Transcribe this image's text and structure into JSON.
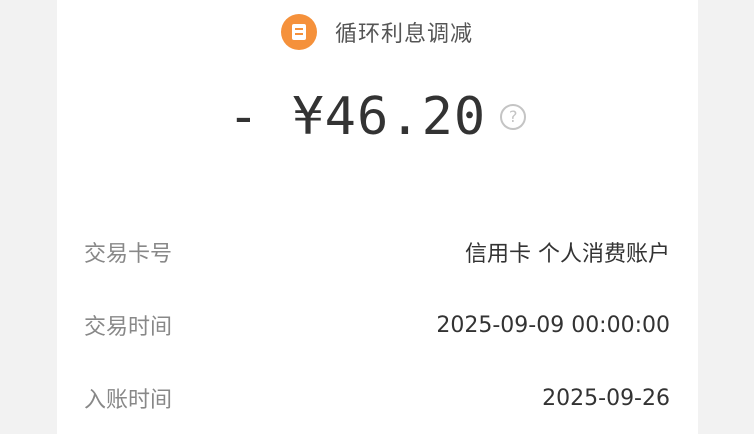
{
  "header": {
    "icon": "receipt-icon",
    "title": "循环利息调减"
  },
  "amount": {
    "text": "- ¥46.20",
    "help_icon": "?"
  },
  "details": [
    {
      "label": "交易卡号",
      "value": "信用卡 个人消费账户"
    },
    {
      "label": "交易时间",
      "value": "2025-09-09 00:00:00"
    },
    {
      "label": "入账时间",
      "value": "2025-09-26"
    }
  ],
  "colors": {
    "accent": "#f5913b",
    "text": "#333333",
    "label": "#888888"
  }
}
